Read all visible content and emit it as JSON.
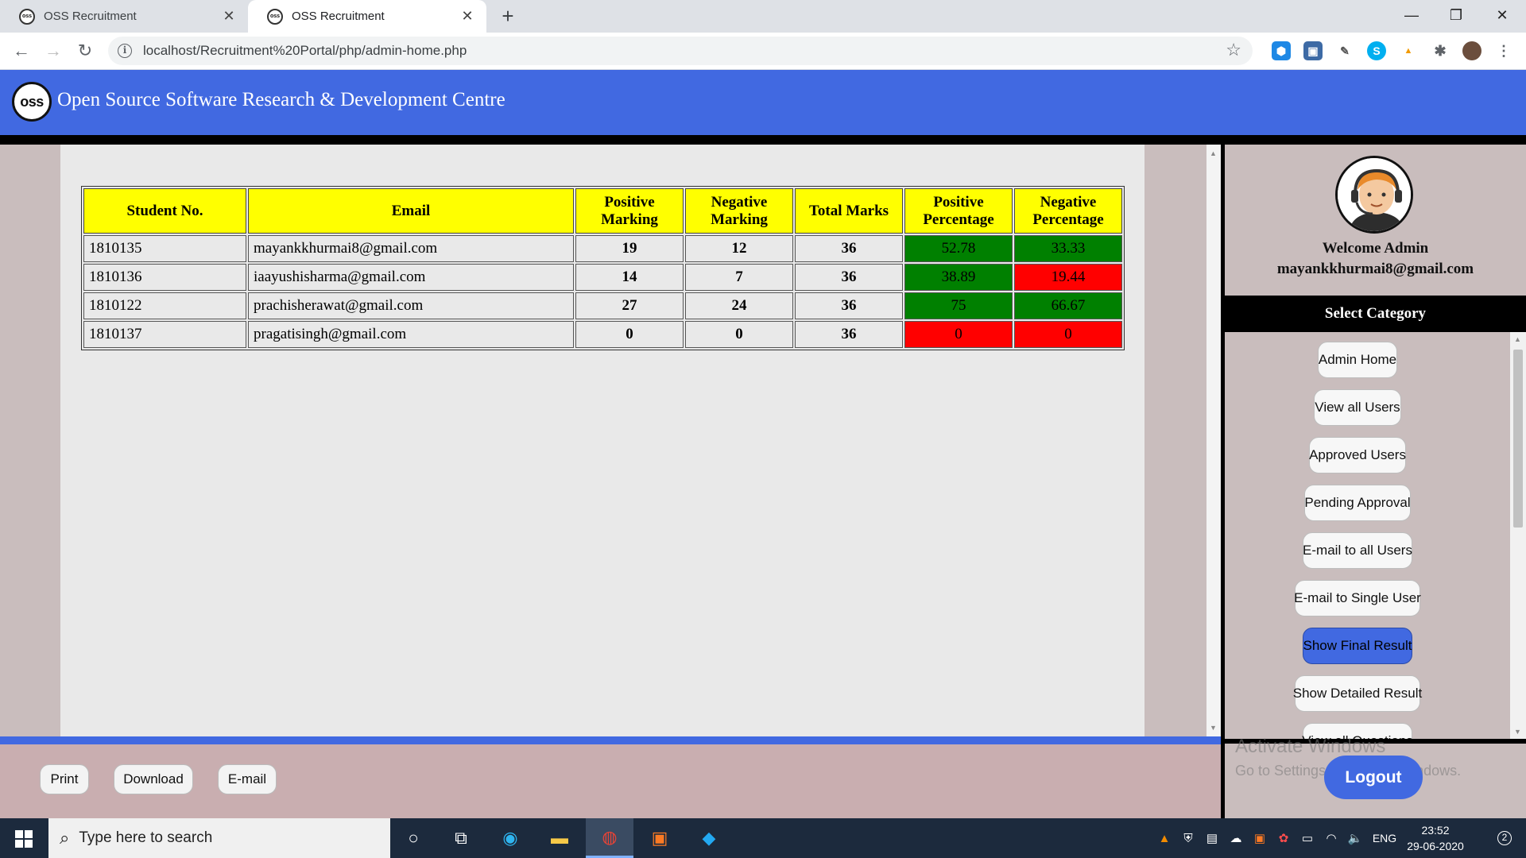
{
  "browser": {
    "tabs": [
      {
        "label": "OSS Recruitment",
        "favicon": "oss"
      },
      {
        "label": "OSS Recruitment",
        "favicon": "oss"
      }
    ],
    "url": "localhost/Recruitment%20Portal/php/admin-home.php"
  },
  "site": {
    "logo_text": "oss",
    "title": "Open Source Software Research & Development Centre"
  },
  "results_table": {
    "headers": [
      "Student No.",
      "Email",
      "Positive Marking",
      "Negative Marking",
      "Total Marks",
      "Positive Percentage",
      "Negative Percentage"
    ],
    "rows": [
      {
        "student_no": "1810135",
        "email": "mayankkhurmai8@gmail.com",
        "positive": "19",
        "negative": "12",
        "total": "36",
        "pos_pct": "52.78",
        "neg_pct": "33.33",
        "pos_color": "#008000",
        "neg_color": "#008000"
      },
      {
        "student_no": "1810136",
        "email": "iaayushisharma@gmail.com",
        "positive": "14",
        "negative": "7",
        "total": "36",
        "pos_pct": "38.89",
        "neg_pct": "19.44",
        "pos_color": "#008000",
        "neg_color": "#ff0000"
      },
      {
        "student_no": "1810122",
        "email": "prachisherawat@gmail.com",
        "positive": "27",
        "negative": "24",
        "total": "36",
        "pos_pct": "75",
        "neg_pct": "66.67",
        "pos_color": "#008000",
        "neg_color": "#008000"
      },
      {
        "student_no": "1810137",
        "email": "pragatisingh@gmail.com",
        "positive": "0",
        "negative": "0",
        "total": "36",
        "pos_pct": "0",
        "neg_pct": "0",
        "pos_color": "#ff0000",
        "neg_color": "#ff0000"
      }
    ]
  },
  "footer_buttons": {
    "print": "Print",
    "download": "Download",
    "email": "E-mail"
  },
  "sidebar": {
    "welcome": "Welcome Admin",
    "admin_email": "mayankkhurmai8@gmail.com",
    "select_category": "Select Category",
    "menu": [
      "Admin Home",
      "View all Users",
      "Approved Users",
      "Pending Approval",
      "E-mail to all Users",
      "E-mail to Single User",
      "Show Final Result",
      "Show Detailed Result",
      "View all Questions"
    ],
    "active_item": "Show Final Result",
    "logout": "Logout"
  },
  "watermark": {
    "line1": "Activate Windows",
    "line2": "Go to Settings to activate Windows."
  },
  "taskbar": {
    "search_placeholder": "Type here to search",
    "language": "ENG",
    "time": "23:52",
    "date": "29-06-2020",
    "notification_count": "2"
  },
  "colors": {
    "brand_blue": "#4169e1",
    "header_yellow": "#ffff00",
    "good_green": "#008000",
    "bad_red": "#ff0000"
  }
}
